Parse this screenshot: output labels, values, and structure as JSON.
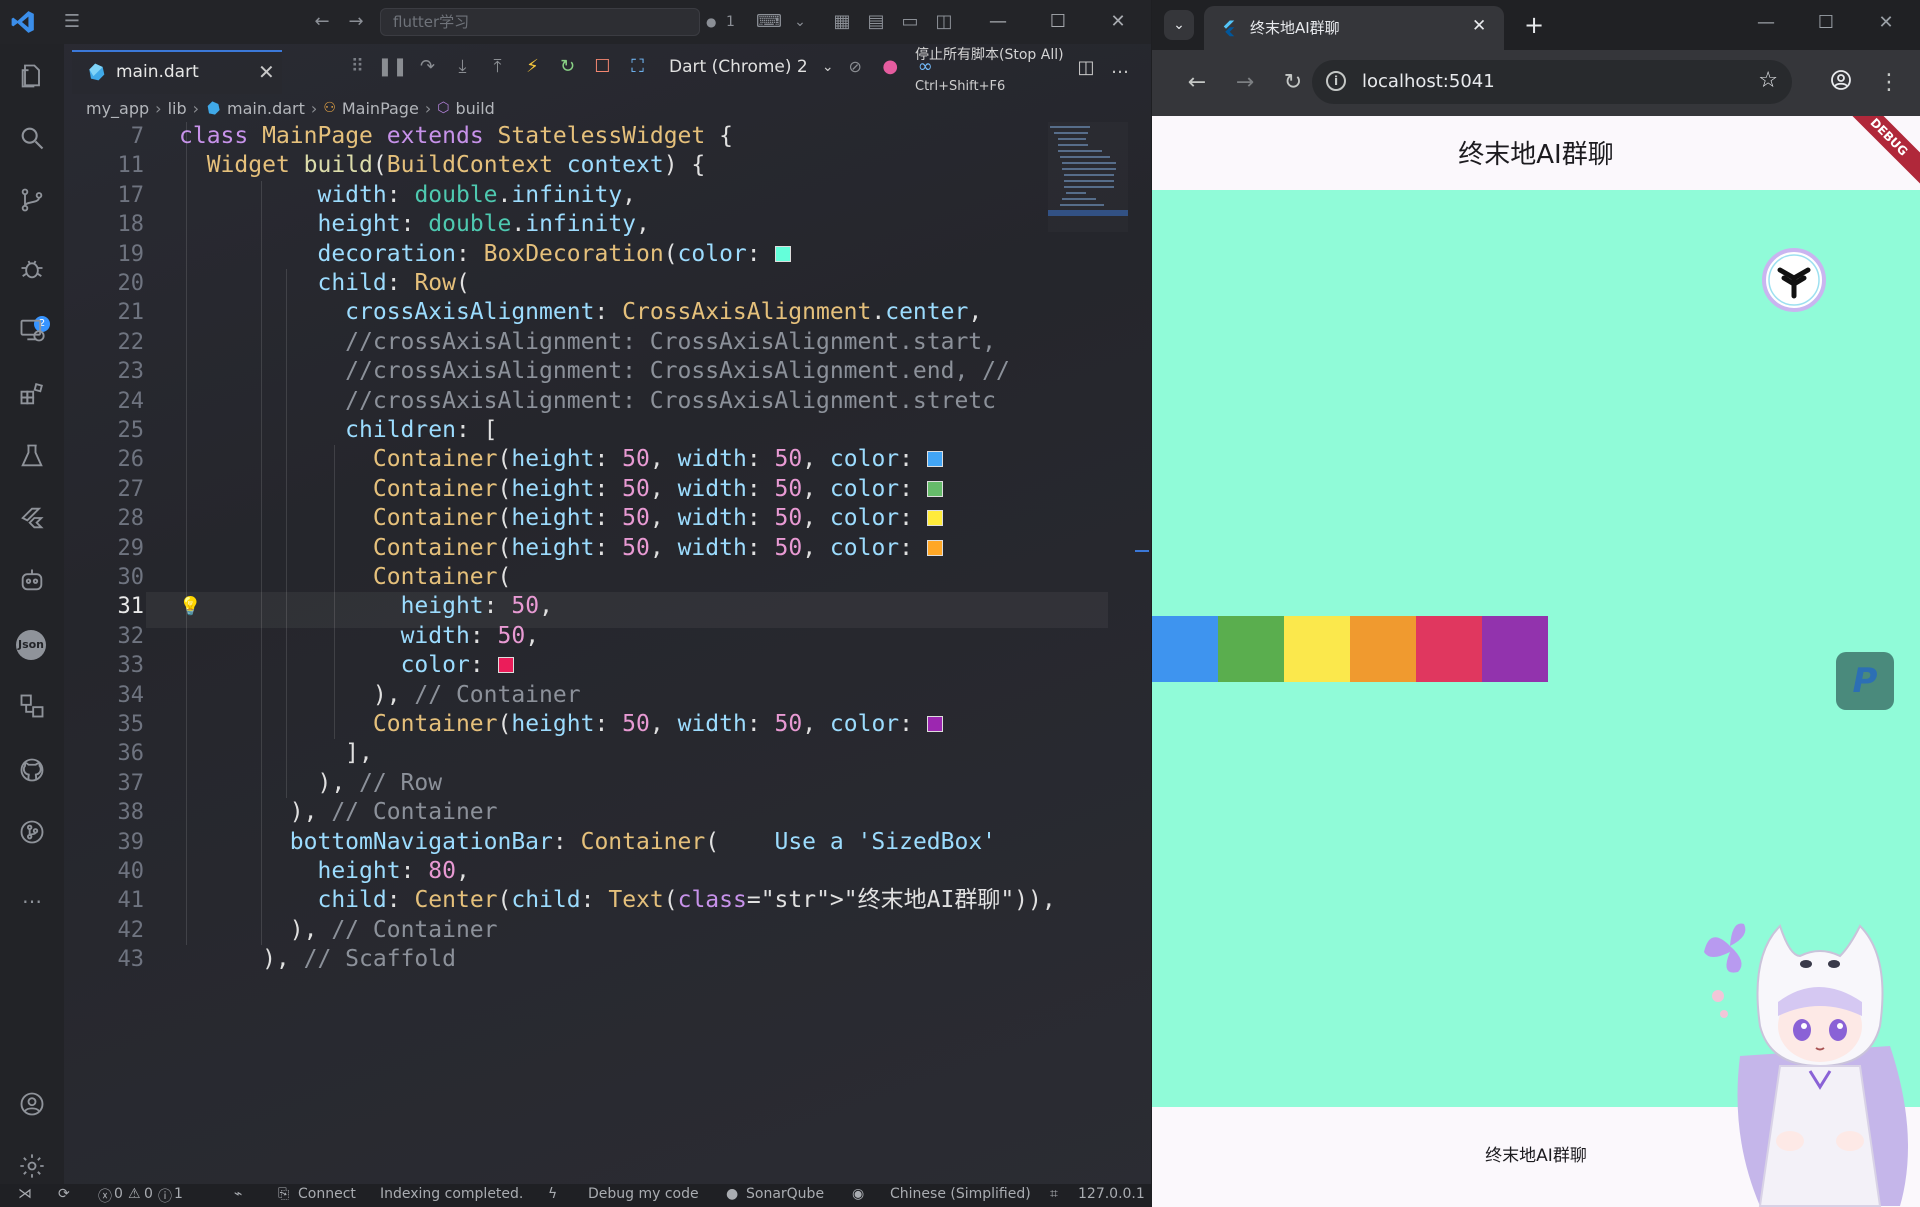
{
  "vscode": {
    "command_center": "flutter学习",
    "notifications": "1",
    "tab": {
      "label": "main.dart"
    },
    "debug": {
      "target": "Dart (Chrome) 2"
    },
    "tooltip": {
      "text": "停止所有脚本(Stop All)",
      "shortcut": "Ctrl+Shift+F6"
    },
    "breadcrumb": [
      "my_app",
      "lib",
      "main.dart",
      "MainPage",
      "build"
    ],
    "activity_badge": "2",
    "line_numbers": [
      "7",
      "11",
      "17",
      "18",
      "19",
      "20",
      "21",
      "22",
      "23",
      "24",
      "25",
      "26",
      "27",
      "28",
      "29",
      "30",
      "31",
      "32",
      "33",
      "34",
      "35",
      "36",
      "37",
      "38",
      "39",
      "40",
      "41",
      "42",
      "43"
    ],
    "current_line": "31",
    "code_lines": [
      "class MainPage extends StatelessWidget {",
      "  Widget build(BuildContext context) {",
      "          width: double.infinity,",
      "          height: double.infinity,",
      "          decoration: BoxDecoration(color: ",
      "          child: Row(",
      "            crossAxisAlignment: CrossAxisAlignment.center,",
      "            //crossAxisAlignment: CrossAxisAlignment.start,",
      "            //crossAxisAlignment: CrossAxisAlignment.end, //",
      "            //crossAxisAlignment: CrossAxisAlignment.stretc",
      "            children: [",
      "              Container(height: 50, width: 50, color: ",
      "              Container(height: 50, width: 50, color: ",
      "              Container(height: 50, width: 50, color: ",
      "              Container(height: 50, width: 50, color: ",
      "              Container(",
      "                height: 50,",
      "                width: 50,",
      "                color: ",
      "              ), // Container",
      "              Container(height: 50, width: 50, color: ",
      "            ],",
      "          ), // Row",
      "        ), // Container",
      "        bottomNavigationBar: Container(",
      "          height: 80,",
      "          child: Center(child: Text(\"终末地AI群聊\")),",
      "        ), // Container",
      "      ), // Scaffold"
    ],
    "inline_hint": "Use a 'SizedBox'",
    "swatch_colors": [
      "#64ffda",
      "#42a5f5",
      "#66bb6a",
      "#ffeb3b",
      "#ffa726",
      "#eb1d5a",
      "#9c27b0"
    ],
    "status": {
      "errors": "0",
      "warnings": "0",
      "info": "1",
      "connect": "Connect",
      "indexing": "Indexing completed.",
      "debug": "Debug my code",
      "sonar": "SonarQube",
      "language": "Chinese (Simplified)",
      "ip": "127.0.0.1"
    }
  },
  "chrome": {
    "tab_title": "终末地AI群聊",
    "url": "localhost:5041"
  },
  "app": {
    "appbar_title": "终末地AI群聊",
    "debug_banner": "DEBUG",
    "background": "#90fbd8",
    "box_colors": [
      "#3e94ef",
      "#5aae4e",
      "#fbe84c",
      "#f09a2f",
      "#e0375f",
      "#9233ad"
    ],
    "bottom_label": "终末地AI群聊",
    "ext_p_label": "P"
  }
}
